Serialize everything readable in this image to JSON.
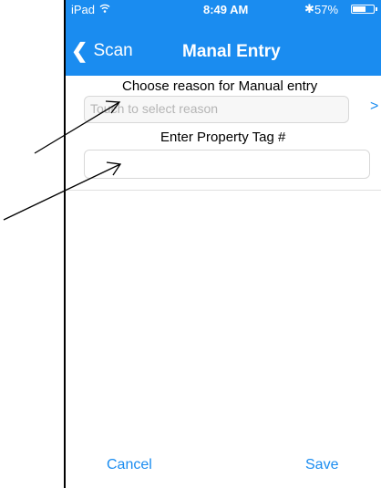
{
  "status_bar": {
    "carrier": "iPad",
    "time": "8:49 AM",
    "battery": "57%"
  },
  "navbar": {
    "back_label": "Scan",
    "title": "Manal Entry"
  },
  "form": {
    "reason_label": "Choose reason for Manual entry",
    "reason_placeholder": "Touch to select reason",
    "reason_chevron": ">",
    "tag_label": "Enter Property Tag #",
    "tag_value": ""
  },
  "bottom_bar": {
    "cancel_label": "Cancel",
    "save_label": "Save"
  },
  "colors": {
    "accent": "#1a8cf0",
    "header_text": "#ffffff"
  },
  "icons": [
    "wifi-icon",
    "bluetooth-icon",
    "battery-icon",
    "chevron-left-icon",
    "chevron-right-icon"
  ]
}
